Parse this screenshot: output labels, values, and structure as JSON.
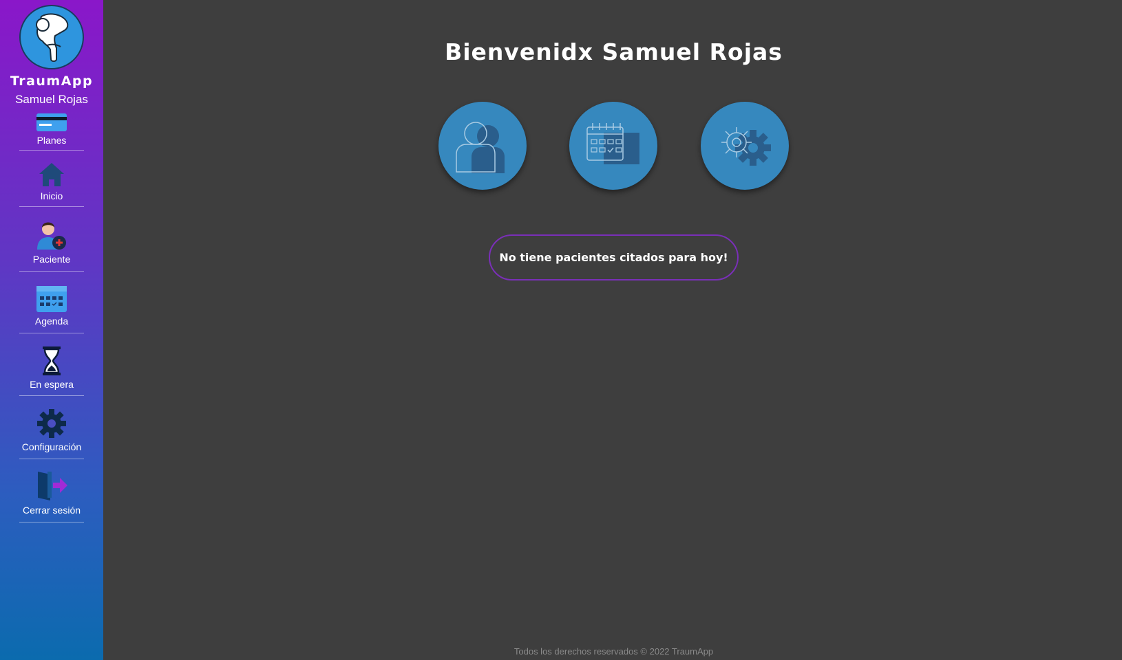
{
  "sidebar": {
    "brand": "TraumApp",
    "user_name": "Samuel Rojas",
    "items": [
      {
        "label": "Planes",
        "icon": "credit-card-icon"
      },
      {
        "label": "Inicio",
        "icon": "home-icon"
      },
      {
        "label": "Paciente",
        "icon": "patient-add-icon"
      },
      {
        "label": "Agenda",
        "icon": "calendar-icon"
      },
      {
        "label": "En espera",
        "icon": "hourglass-icon"
      },
      {
        "label": "Configuración",
        "icon": "gear-icon"
      },
      {
        "label": "Cerrar sesión",
        "icon": "logout-door-icon"
      }
    ]
  },
  "main": {
    "title": "Bienvenidx Samuel Rojas",
    "shortcuts": [
      {
        "icon": "patient-icon"
      },
      {
        "icon": "calendar-icon"
      },
      {
        "icon": "settings-gears-icon"
      }
    ],
    "notice": "No tiene pacientes citados para hoy!"
  },
  "footer": "Todos los derechos reservados © 2022 TraumApp",
  "colors": {
    "sidebar_top": "#8a17c9",
    "sidebar_bottom": "#0b6bae",
    "background": "#3e3e3e",
    "circle": "#3688be",
    "notice_border": "#7a2fb8"
  }
}
